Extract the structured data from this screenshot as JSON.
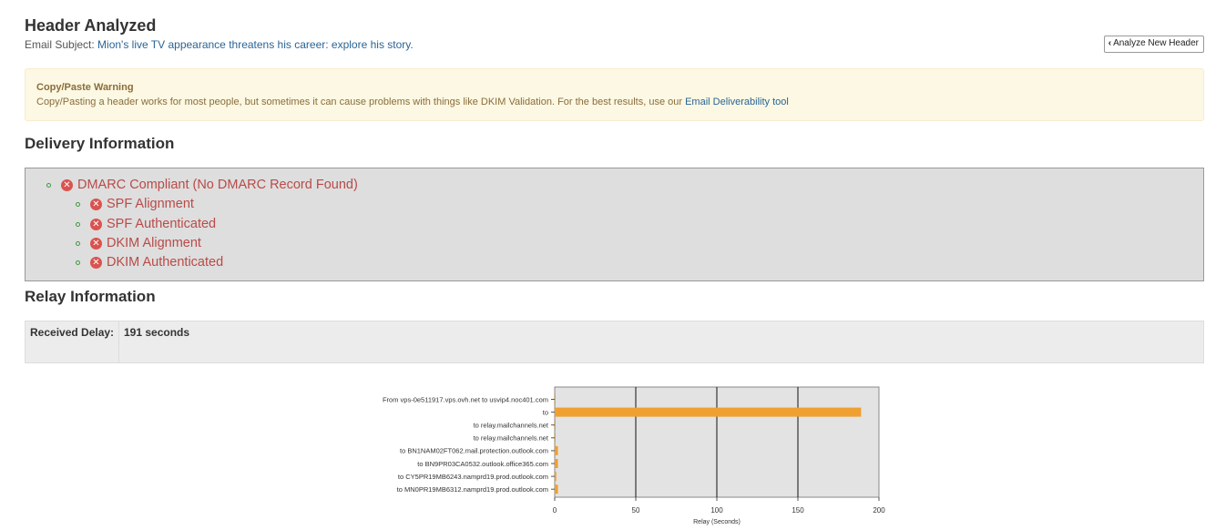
{
  "header": {
    "title": "Header Analyzed",
    "subject_label": "Email Subject:",
    "subject": "Mion's live TV appearance threatens his career: explore his story.",
    "analyze_button": "Analyze New Header"
  },
  "warning": {
    "title": "Copy/Paste Warning",
    "text": "Copy/Pasting a header works for most people, but sometimes it can cause problems with things like DKIM Validation. For the best results, use our",
    "link": "Email Deliverability tool"
  },
  "delivery": {
    "title": "Delivery Information",
    "items": [
      {
        "label": "DMARC Compliant (No DMARC Record Found)",
        "status": "fail",
        "level": 0
      },
      {
        "label": "SPF Alignment",
        "status": "fail",
        "level": 1
      },
      {
        "label": "SPF Authenticated",
        "status": "fail",
        "level": 1
      },
      {
        "label": "DKIM Alignment",
        "status": "fail",
        "level": 1
      },
      {
        "label": "DKIM Authenticated",
        "status": "fail",
        "level": 1
      }
    ]
  },
  "relay": {
    "title": "Relay Information",
    "received_delay_label": "Received Delay:",
    "received_delay_value": "191 seconds"
  },
  "chart_data": {
    "type": "bar",
    "orientation": "horizontal",
    "categories": [
      "From vps-0e511917.vps.ovh.net to usvip4.noc401.com",
      "to",
      "to relay.mailchannels.net",
      "to relay.mailchannels.net",
      "to  BN1NAM02FT062.mail.protection.outlook.com",
      "to  BN9PR03CA0532.outlook.office365.com",
      "to  CY5PR19MB6243.namprd19.prod.outlook.com",
      "to  MN0PR19MB6312.namprd19.prod.outlook.com"
    ],
    "values": [
      0,
      189,
      0,
      0,
      2,
      2,
      1,
      2
    ],
    "xlabel": "Relay (Seconds)",
    "ylabel": "",
    "xlim": [
      0,
      200
    ],
    "xticks": [
      "0",
      "50",
      "100",
      "150",
      "200"
    ],
    "grid": true,
    "colors": {
      "bar": "#f0a030",
      "plot_bg": "#e3e3e3"
    }
  },
  "colors": {
    "fail": "#b94a48",
    "fail_icon": "#d9534f",
    "bullet": "#3c9a3c",
    "link": "#2a6496"
  }
}
